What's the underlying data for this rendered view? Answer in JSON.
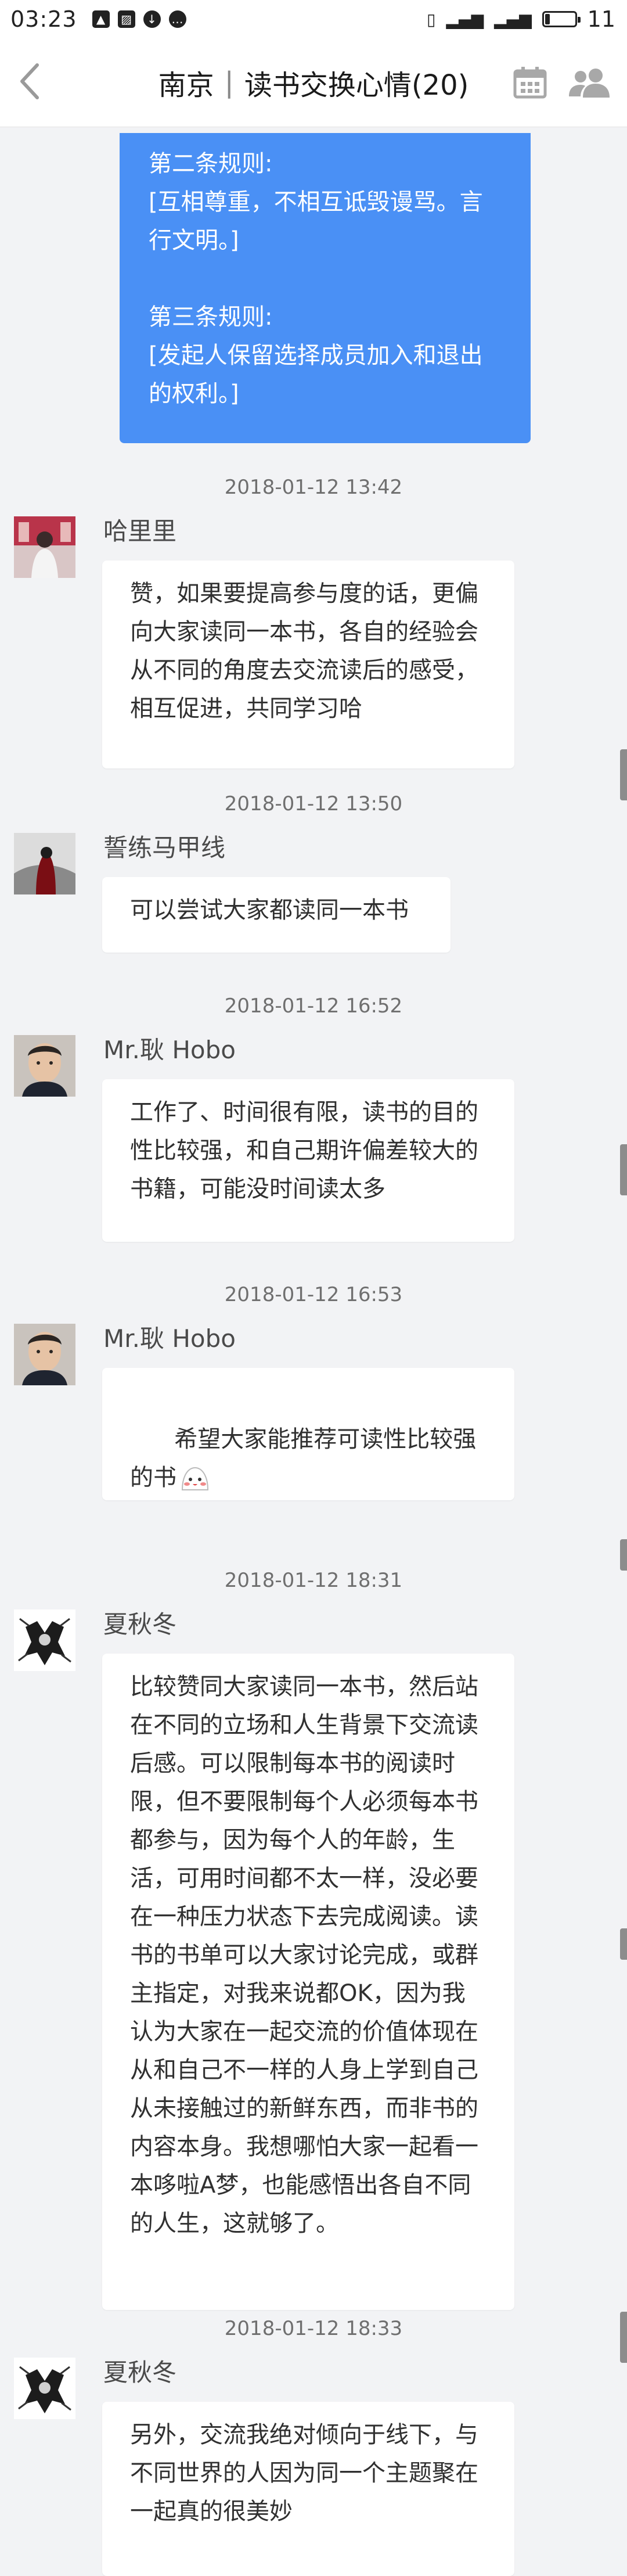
{
  "status_bar": {
    "time": "03:23",
    "battery": "11"
  },
  "header": {
    "city": "南京",
    "separator": "|",
    "group": "读书交换心情(20)"
  },
  "pinned_notice": {
    "text": "第二条规则:\n[互相尊重，不相互诋毁谩骂。言行文明。]\n\n第三条规则:\n[发起人保留选择成员加入和退出的权利。]"
  },
  "messages": [
    {
      "timestamp": "2018-01-12 13:42",
      "sender": "哈里里",
      "avatar": "avatar-photo-icon",
      "text": "赞，如果要提高参与度的话，更偏向大家读同一本书，各自的经验会从不同的角度去交流读后的感受，相互促进，共同学习哈"
    },
    {
      "timestamp": "2018-01-12 13:50",
      "sender": "誓练马甲线",
      "avatar": "avatar-photo-icon",
      "text": "可以尝试大家都读同一本书"
    },
    {
      "timestamp": "2018-01-12 16:52",
      "sender": "Mr.耿 Hobo",
      "avatar": "avatar-photo-icon",
      "text": "工作了、时间很有限，读书的目的性比较强，和自己期许偏差较大的书籍，可能没时间读太多"
    },
    {
      "timestamp": "2018-01-12 16:53",
      "sender": "Mr.耿 Hobo",
      "avatar": "avatar-photo-icon",
      "text": "希望大家能推荐可读性比较强的书",
      "emoji": "blush-emoji-icon"
    },
    {
      "timestamp": "2018-01-12 18:31",
      "sender": "夏秋冬",
      "avatar": "avatar-photo-icon",
      "text": "比较赞同大家读同一本书，然后站在不同的立场和人生背景下交流读后感。可以限制每本书的阅读时限，但不要限制每个人必须每本书都参与，因为每个人的年龄，生活，可用时间都不太一样，没必要在一种压力状态下去完成阅读。读书的书单可以大家讨论完成，或群主指定，对我来说都OK，因为我认为大家在一起交流的价值体现在从和自己不一样的人身上学到自己从未接触过的新鲜东西，而非书的内容本身。我想哪怕大家一起看一本哆啦A梦，也能感悟出各自不同的人生，这就够了。"
    },
    {
      "timestamp": "2018-01-12 18:33",
      "sender": "夏秋冬",
      "avatar": "avatar-photo-icon",
      "text": "另外，交流我绝对倾向于线下，与不同世界的人因为同一个主题聚在一起真的很美妙"
    }
  ],
  "colors": {
    "accent_blue": "#4a90f5",
    "background": "#f2f3f5"
  }
}
